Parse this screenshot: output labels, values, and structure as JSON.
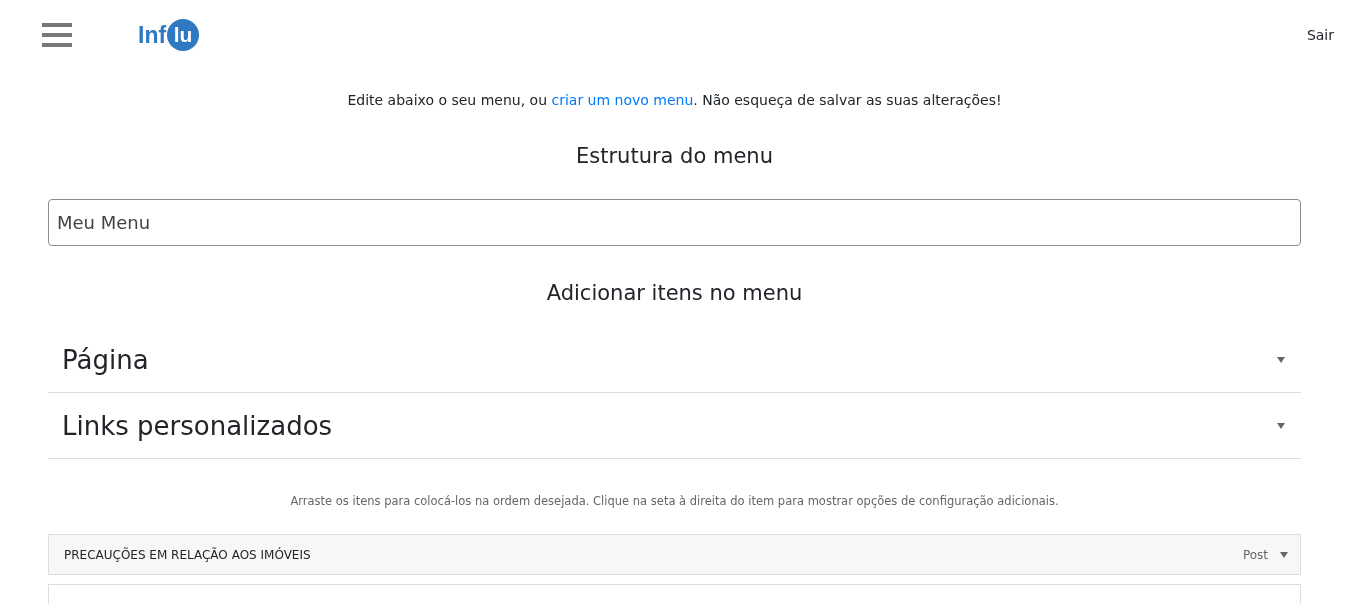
{
  "header": {
    "logo": {
      "text": "Inf",
      "badge": "lu"
    },
    "logout": "Sair"
  },
  "intro": {
    "before": "Edite abaixo o seu menu, ou ",
    "link": "criar um novo menu",
    "after": ". Não esqueça de salvar as suas alterações!"
  },
  "structure_title": "Estrutura do menu",
  "menu_name": {
    "value": "Meu Menu"
  },
  "add_title": "Adicionar itens no menu",
  "sections": [
    {
      "label": "Página",
      "expanded": false
    },
    {
      "label": "Links personalizados",
      "expanded": false
    }
  ],
  "hint": "Arraste os itens para colocá-los na ordem desejada. Clique na seta à direita do item para mostrar opções de configuração adicionais.",
  "menu_items": [
    {
      "title": "PRECAUÇÕES EM RELAÇÃO AOS IMÓVEIS",
      "type": "Post",
      "expanded": false
    }
  ]
}
